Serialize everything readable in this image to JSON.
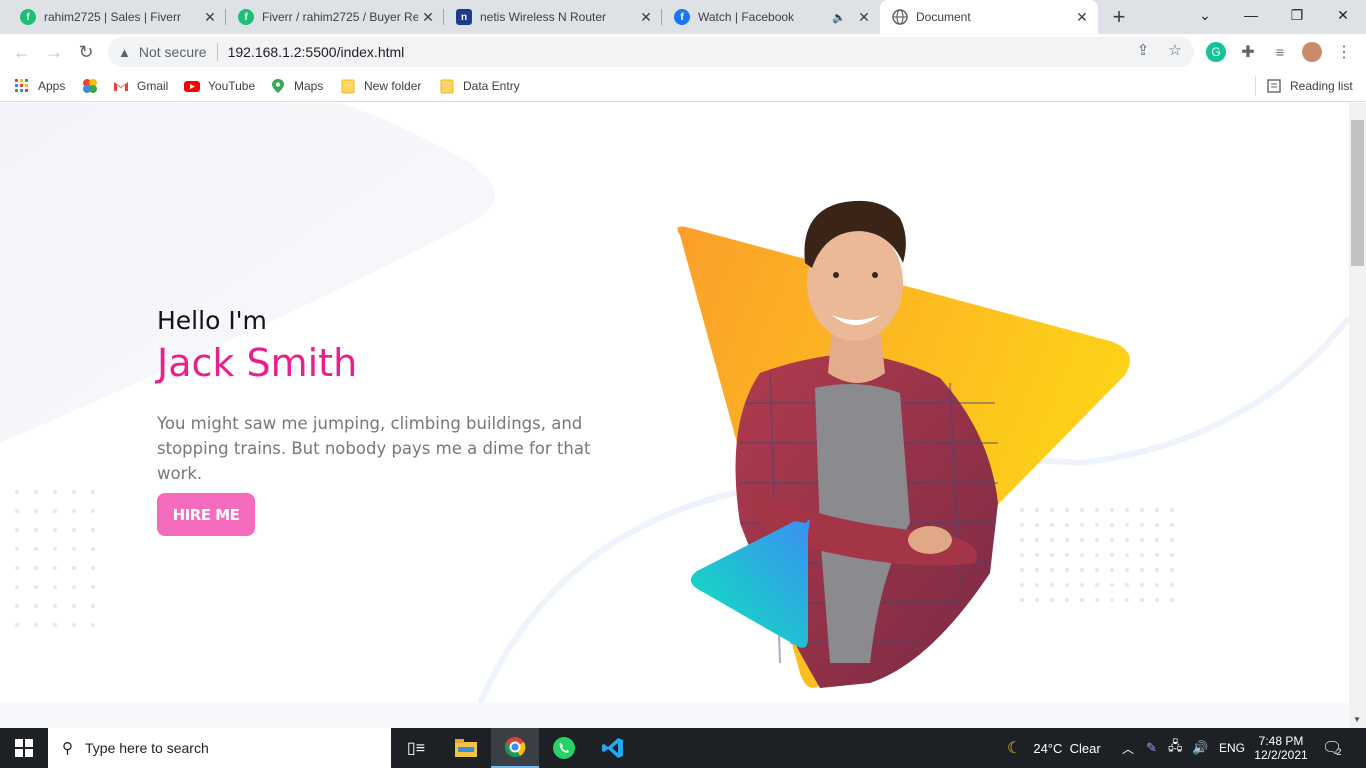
{
  "tabs": [
    {
      "title": "rahim2725 | Sales | Fiverr",
      "icon": "fiverr-icon",
      "color": "#1dbf73"
    },
    {
      "title": "Fiverr / rahim2725 / Buyer Re",
      "icon": "fiverr-icon",
      "color": "#1dbf73"
    },
    {
      "title": "netis Wireless N Router",
      "icon": "netis-icon",
      "color": "#1e3c8c"
    },
    {
      "title": "Watch | Facebook",
      "icon": "facebook-icon",
      "color": "#1877f2"
    },
    {
      "title": "Document",
      "icon": "globe-icon",
      "color": "#5f6368"
    }
  ],
  "toolbar": {
    "security_label": "Not secure",
    "url": "192.168.1.2:5500/index.html"
  },
  "bookmarks": {
    "apps": "Apps",
    "items": [
      "Gmail",
      "YouTube",
      "Maps",
      "New folder",
      "Data Entry"
    ],
    "reading_list": "Reading list"
  },
  "hero": {
    "greeting": "Hello I'm",
    "name": "Jack Smith",
    "description": "You might saw me jumping, climbing buildings, and stopping trains. But nobody pays me a dime for that work.",
    "button": "HIRE ME",
    "accent_color": "#ec1e8c"
  },
  "taskbar": {
    "search_placeholder": "Type here to search",
    "weather": "24°C  Clear",
    "language": "ENG",
    "time": "7:48 PM",
    "date": "12/2/2021",
    "notifications": "2"
  }
}
